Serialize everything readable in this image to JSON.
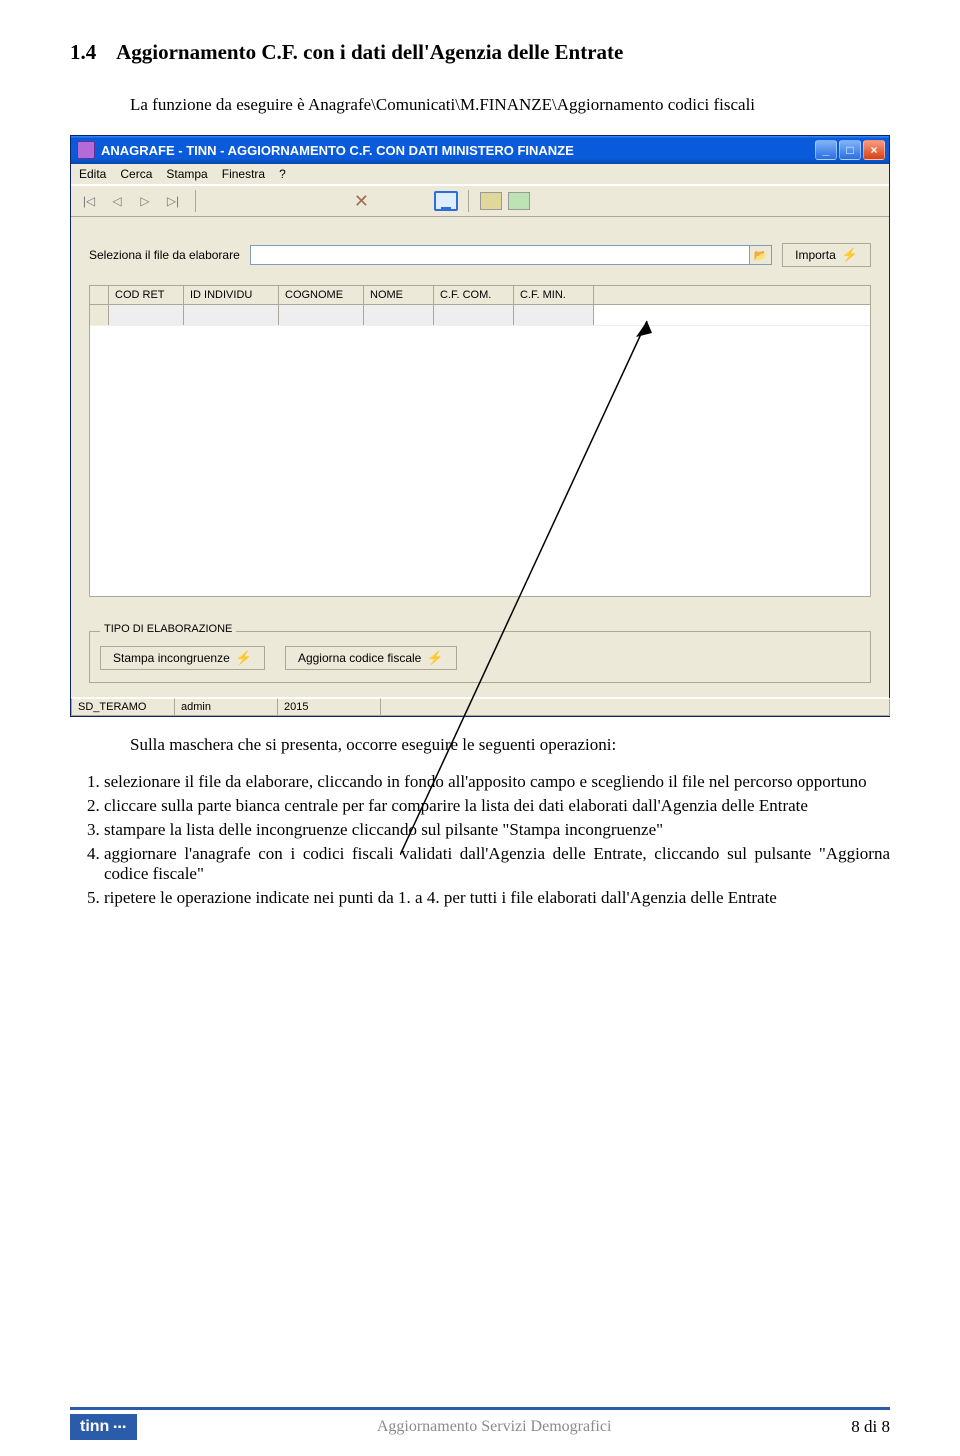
{
  "section": {
    "number": "1.4",
    "title": "Aggiornamento C.F. con i dati dell'Agenzia delle Entrate"
  },
  "intro": "La funzione da eseguire è Anagrafe\\Comunicati\\M.FINANZE\\Aggiornamento codici fiscali",
  "window": {
    "title": "ANAGRAFE - TINN - AGGIORNAMENTO C.F. CON DATI MINISTERO FINANZE",
    "menu": [
      "Edita",
      "Cerca",
      "Stampa",
      "Finestra",
      "?"
    ],
    "file_label": "Seleziona il file da elaborare",
    "file_value": "",
    "importa": "Importa",
    "columns": [
      "COD RET",
      "ID INDIVIDU",
      "COGNOME",
      "NOME",
      "C.F. COM.",
      "C.F. MIN."
    ],
    "group_legend": "TIPO DI ELABORAZIONE",
    "btn_stampa": "Stampa incongruenze",
    "btn_aggiorna": "Aggiorna codice fiscale",
    "status": {
      "db": "SD_TERAMO",
      "user": "admin",
      "year": "2015"
    }
  },
  "after_intro": "Sulla maschera che si presenta,  occorre eseguire le seguenti operazioni:",
  "steps": [
    "selezionare il file da elaborare, cliccando in fondo all'apposito campo e scegliendo il file nel percorso opportuno",
    "cliccare sulla parte bianca centrale per far comparire la lista dei dati elaborati dall'Agenzia delle Entrate",
    "stampare la lista delle incongruenze cliccando sul pilsante \"Stampa incongruenze\"",
    "aggiornare l'anagrafe con i codici fiscali validati dall'Agenzia delle Entrate, cliccando sul pulsante \"Aggiorna codice fiscale\"",
    "ripetere le operazione indicate nei punti da 1. a 4. per tutti i file elaborati dall'Agenzia delle Entrate"
  ],
  "footer": {
    "brand": "tinn",
    "center": "Aggiornamento Servizi Demografici",
    "page": "8 di 8"
  }
}
